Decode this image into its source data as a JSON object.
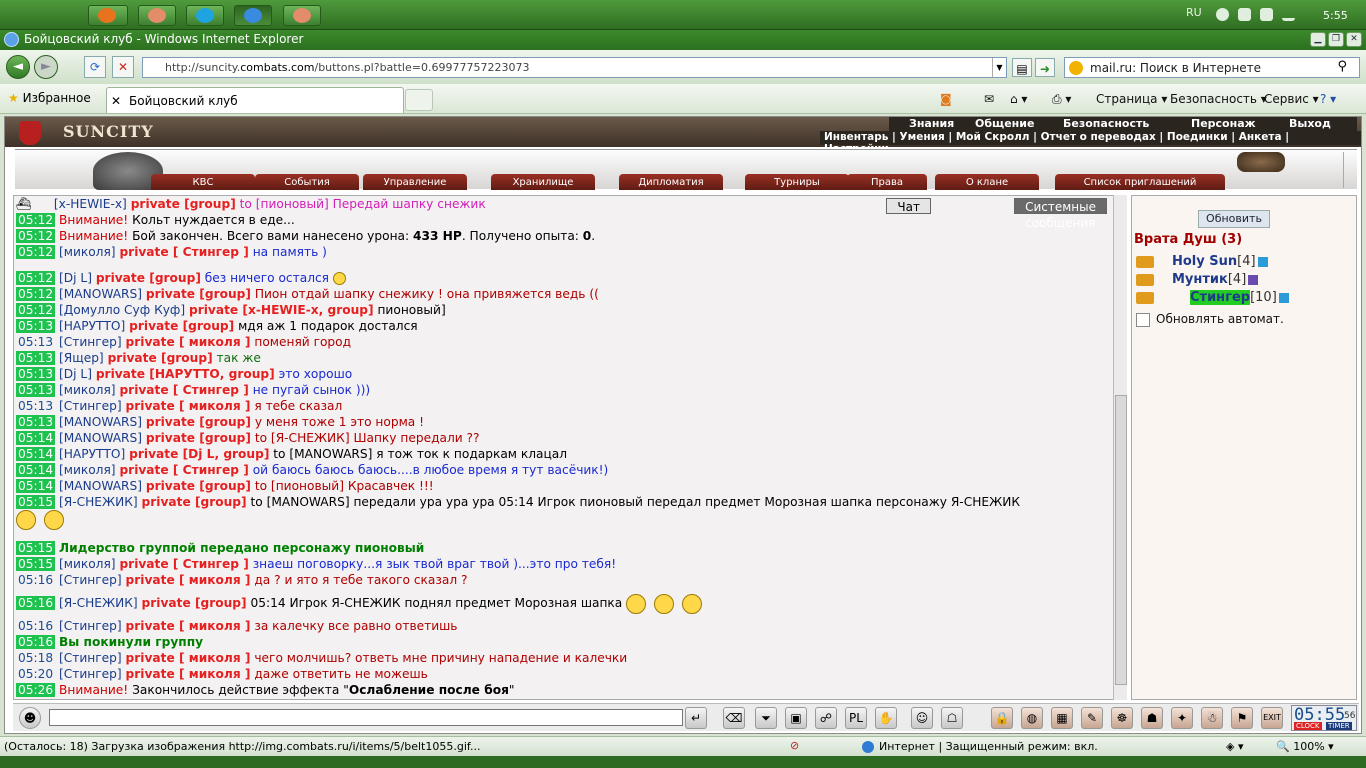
{
  "taskbar": {
    "lang": "RU",
    "time": "5:55"
  },
  "window": {
    "title": "Бойцовский клуб - Windows Internet Explorer"
  },
  "browser": {
    "url_prefix": "http://suncity.",
    "url_domain": "combats.com",
    "url_rest": "/buttons.pl?battle=0.69977757223073",
    "search_text": "mail.ru: Поиск в Интернете",
    "favorites": "Избранное",
    "tab_title": "Бойцовский клуб",
    "cmd_page": "Страница ▾",
    "cmd_safety": "Безопасность ▾",
    "cmd_service": "Сервис ▾",
    "cmd_help": "? ▾"
  },
  "game": {
    "logo": "SUNCITY",
    "menu1": [
      "Знания",
      "Общение",
      "Безопасность",
      "Персонаж",
      "Выход"
    ],
    "menu2": "Инвентарь | Умения | Мой Скролл | Отчет о переводах | Поединки | Анкета | Настройки",
    "navtabs": [
      "КВС",
      "События",
      "Управление",
      "Хранилище",
      "Дипломатия",
      "Турниры",
      "Права",
      "О клане",
      "Список приглашений"
    ],
    "chat_tabs": [
      "Чат",
      "Системные сообщения"
    ]
  },
  "chat": {
    "l1": {
      "nick": "[x-HEWIE-x]",
      "priv": "private [group]",
      "text": "to [пионовый] Передай шапку снежик"
    },
    "l2": {
      "ts": "05:12",
      "warn": "Внимание!",
      "text": "Кольт нуждается в еде..."
    },
    "l3": {
      "ts": "05:12",
      "warn": "Внимание!",
      "text_a": "Бой закончен. Всего вами нанесено урона: ",
      "b1": "433 HP",
      "text_b": ". Получено опыта: ",
      "b2": "0",
      "text_c": "."
    },
    "l4": {
      "ts": "05:12",
      "nick": "[миколя]",
      "priv": "private [ Стингер ]",
      "text": "на память )"
    },
    "l5": {
      "ts": "05:12",
      "nick": "[Dj L]",
      "priv": "private [group]",
      "text": "без ничего остался"
    },
    "l6": {
      "ts": "05:12",
      "nick": "[MANOWARS]",
      "priv": "private [group]",
      "text": "Пион отдай шапку снежику ! она привяжется ведь (("
    },
    "l7": {
      "ts": "05:12",
      "nick": "[Домулло Суф Куф]",
      "priv": "private [x-HEWIE-x, group]",
      "text": "пионовый]"
    },
    "l8": {
      "ts": "05:13",
      "nick": "[НАРУТТО]",
      "priv": "private [group]",
      "text": "мдя аж 1 подарок достался"
    },
    "l9": {
      "ts": "05:13",
      "nick": "[Стингер]",
      "priv": "private [ миколя ]",
      "text": "поменяй город"
    },
    "l10": {
      "ts": "05:13",
      "nick": "[Ящер]",
      "priv": "private [group]",
      "text": "так же"
    },
    "l11": {
      "ts": "05:13",
      "nick": "[Dj L]",
      "priv": "private [НАРУТТО, group]",
      "text": "это хорошо"
    },
    "l12": {
      "ts": "05:13",
      "nick": "[миколя]",
      "priv": "private [ Стингер ]",
      "text": "не пугай сынок )))"
    },
    "l13": {
      "ts": "05:13",
      "nick": "[Стингер]",
      "priv": "private [ миколя ]",
      "text": "я тебе сказал"
    },
    "l14": {
      "ts": "05:13",
      "nick": "[MANOWARS]",
      "priv": "private [group]",
      "text": "у меня тоже 1 это норма !"
    },
    "l15": {
      "ts": "05:14",
      "nick": "[MANOWARS]",
      "priv": "private [group]",
      "text": "to [Я-СНЕЖИК] Шапку передали ??"
    },
    "l16": {
      "ts": "05:14",
      "nick": "[НАРУТТО]",
      "priv": "private [Dj L, group]",
      "text": "to [MANOWARS] я тож ток к подаркам клацал"
    },
    "l17": {
      "ts": "05:14",
      "nick": "[миколя]",
      "priv": "private [ Стингер ]",
      "text": "ой баюсь баюсь баюсь....в любое время я тут васёчик!)"
    },
    "l18": {
      "ts": "05:14",
      "nick": "[MANOWARS]",
      "priv": "private [group]",
      "text": "to [пионовый] Красавчек !!!"
    },
    "l19": {
      "ts": "05:15",
      "nick": "[Я-СНЕЖИК]",
      "priv": "private [group]",
      "text": "to [MANOWARS] передали ура ура ура 05:14 Игрок пионовый передал предмет Морозная шапка персонажу Я-СНЕЖИК"
    },
    "l20": {
      "ts": "05:15",
      "text": "Лидерство группой передано персонажу пионовый"
    },
    "l21": {
      "ts": "05:15",
      "nick": "[миколя]",
      "priv": "private [ Стингер ]",
      "text": "знаеш поговорку...я зык твой враг твой )...это про тебя!"
    },
    "l22": {
      "ts": "05:16",
      "nick": "[Стингер]",
      "priv": "private [ миколя ]",
      "text": "да ? и ято я тебе такого сказал ?"
    },
    "l23": {
      "ts": "05:16",
      "nick": "[Я-СНЕЖИК]",
      "priv": "private [group]",
      "text": "05:14 Игрок Я-СНЕЖИК поднял предмет Морозная шапка"
    },
    "l24": {
      "ts": "05:16",
      "nick": "[Стингер]",
      "priv": "private [ миколя ]",
      "text": "за калечку все равно ответишь"
    },
    "l25": {
      "ts": "05:16",
      "text": "Вы покинули группу"
    },
    "l26": {
      "ts": "05:18",
      "nick": "[Стингер]",
      "priv": "private [ миколя ]",
      "text": "чего молчишь? ответь мне причину нападение и калечки"
    },
    "l27": {
      "ts": "05:20",
      "nick": "[Стингер]",
      "priv": "private [ миколя ]",
      "text": "даже ответить не можешь"
    },
    "l28": {
      "ts": "05:26",
      "warn": "Внимание!",
      "text": "Закончилось действие эффекта \"",
      "bold": "Ослабление после боя",
      "end": "\""
    }
  },
  "side": {
    "refresh": "Обновить",
    "room": "Врата Душ (3)",
    "users": [
      {
        "name": "Holy Sun",
        "level": "[4]"
      },
      {
        "name": "Мунтик",
        "level": "[4]"
      },
      {
        "name": "Стингер",
        "level": "[10]"
      }
    ],
    "auto": "Обновлять автомат."
  },
  "clock": {
    "time": "05:55",
    "sec": "56",
    "clock": "CLOCK",
    "timer": "TIMER"
  },
  "status": {
    "text": "(Осталось: 18) Загрузка изображения http://img.combats.ru/i/items/5/belt1055.gif...",
    "zone": "Интернет | Защищенный режим: вкл.",
    "zoom": "100%"
  }
}
